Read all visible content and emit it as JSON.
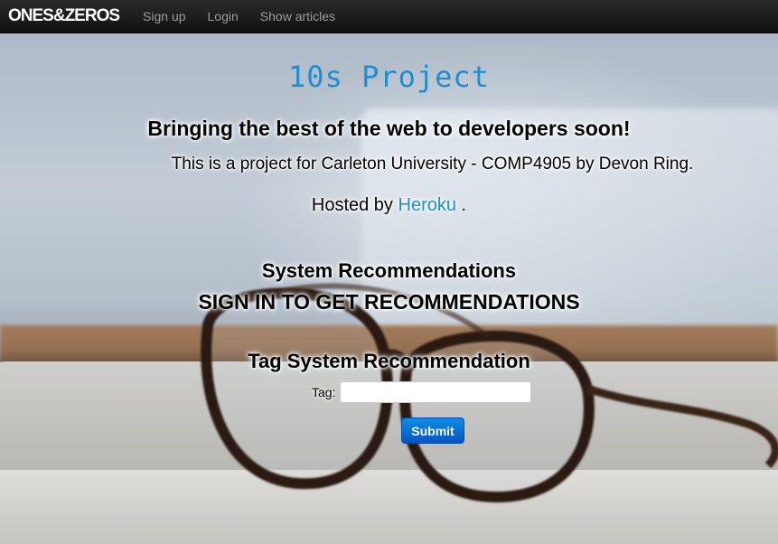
{
  "navbar": {
    "brand": "ONES&ZEROS",
    "links": [
      "Sign up",
      "Login",
      "Show articles"
    ]
  },
  "hero": {
    "title": "10s Project",
    "tagline": "Bringing the best of the web to developers soon!",
    "description": "This is a project for Carleton University - COMP4905 by Devon Ring.",
    "hosted_prefix": "Hosted by",
    "hosted_link": "Heroku",
    "hosted_suffix": "."
  },
  "recommendations": {
    "title": "System Recommendations",
    "signin_message": "SIGN IN TO GET RECOMMENDATIONS"
  },
  "tag_recommendation": {
    "title": "Tag System Recommendation",
    "label": "Tag:",
    "value": "",
    "placeholder": "",
    "submit_label": "Submit"
  },
  "colors": {
    "accent": "#1a8fd6",
    "navbar": "#1b1b1b",
    "button": "#0a6fd6"
  }
}
